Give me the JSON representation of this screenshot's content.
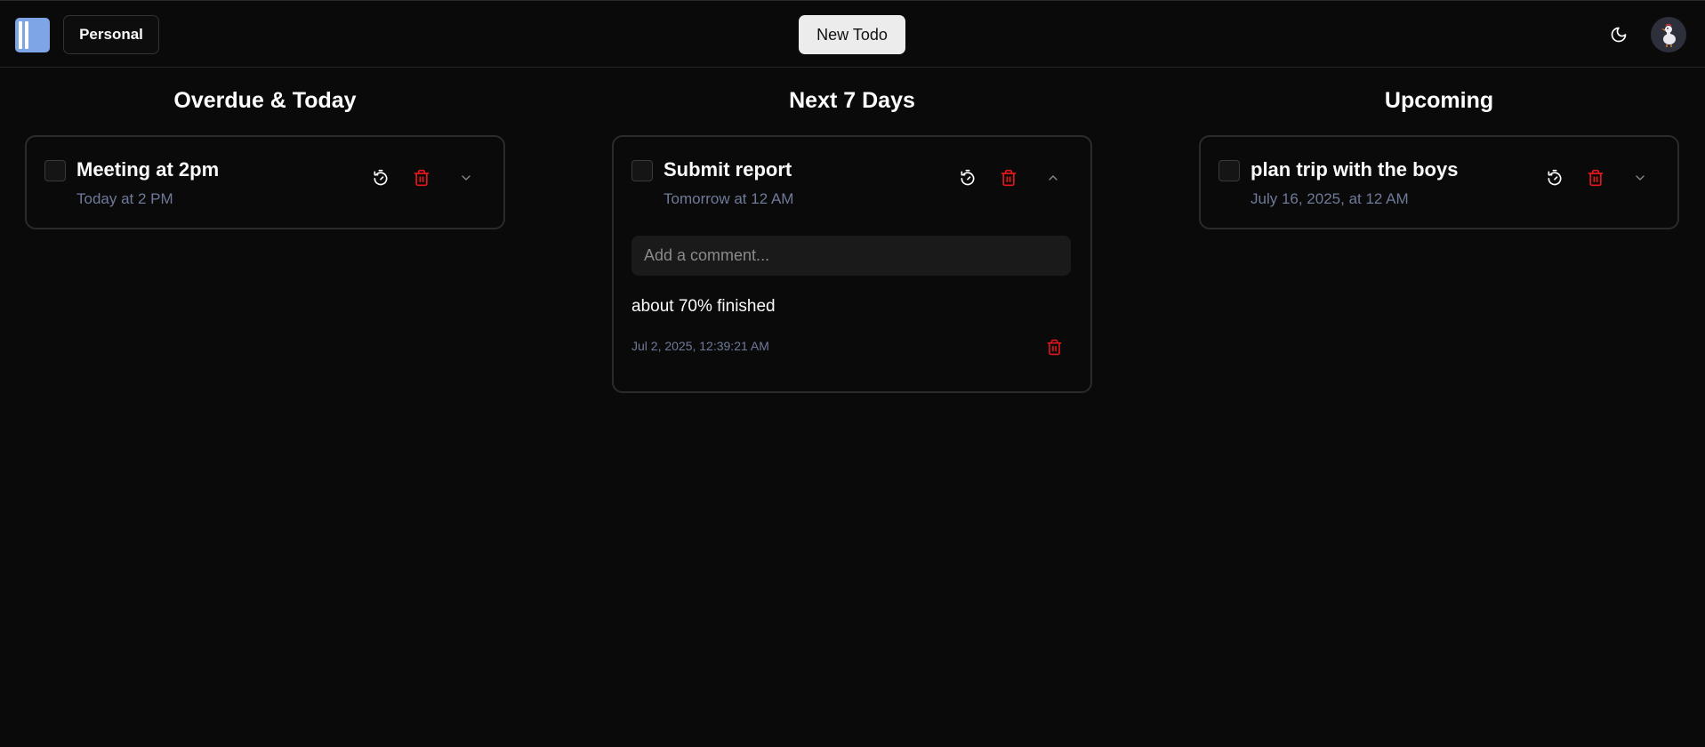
{
  "header": {
    "workspace_label": "Personal",
    "new_todo_label": "New Todo",
    "theme_icon": "moon-icon",
    "logo_icon": "sidebar-toggle-icon"
  },
  "columns": [
    {
      "title": "Overdue & Today",
      "todos": [
        {
          "title": "Meeting at 2pm",
          "date": "Today at 2 PM",
          "expanded": false
        }
      ]
    },
    {
      "title": "Next 7 Days",
      "todos": [
        {
          "title": "Submit report",
          "date": "Tomorrow at 12 AM",
          "expanded": true,
          "comment_placeholder": "Add a comment...",
          "comments": [
            {
              "text": "about 70% finished",
              "timestamp": "Jul 2, 2025, 12:39:21 AM"
            }
          ]
        }
      ]
    },
    {
      "title": "Upcoming",
      "todos": [
        {
          "title": "plan trip with the boys",
          "date": "July 16, 2025, at 12 AM",
          "expanded": false
        }
      ]
    }
  ],
  "colors": {
    "background": "#0a0a0a",
    "delete": "#e5161b",
    "muted_date": "#6f7a99",
    "logo": "#7ea6e6"
  }
}
